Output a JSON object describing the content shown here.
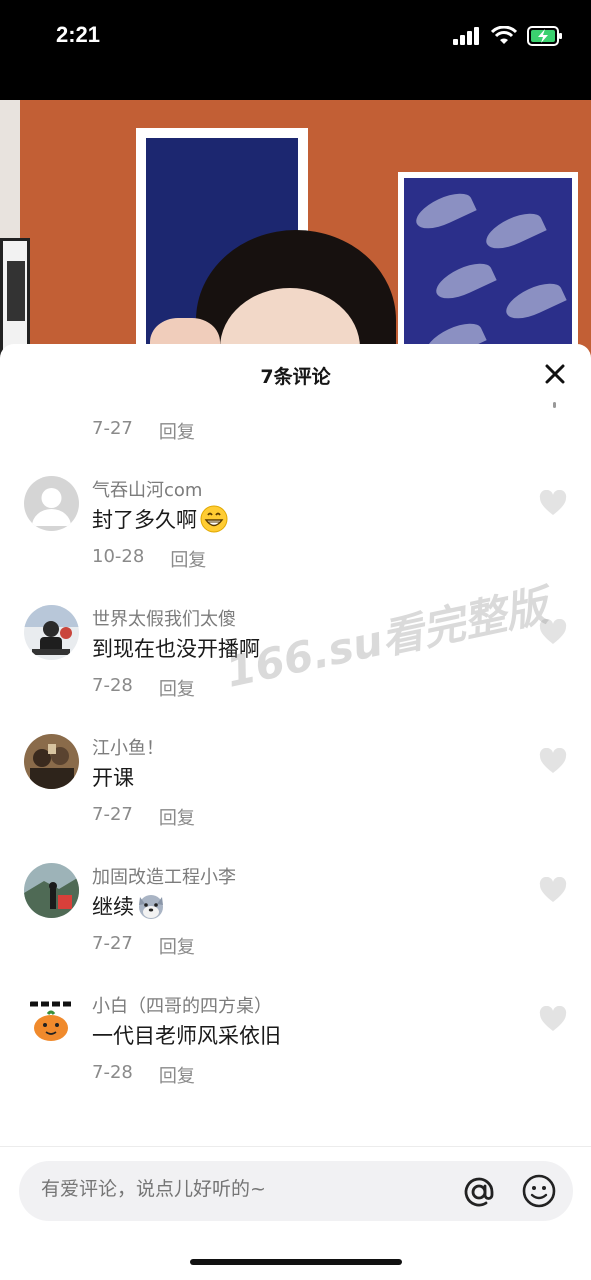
{
  "status_bar": {
    "time": "2:21"
  },
  "sheet": {
    "title": "7条评论"
  },
  "partial_comment": {
    "date": "7-27",
    "reply_label": "回复"
  },
  "comments": [
    {
      "name": "气吞山河com",
      "text": "封了多久啊",
      "emoji": "grin-emoji",
      "date": "10-28",
      "reply_label": "回复"
    },
    {
      "name": "世界太假我们太傻",
      "text": "到现在也没开播啊",
      "date": "7-28",
      "reply_label": "回复"
    },
    {
      "name": "江小鱼！",
      "text": "开课",
      "date": "7-27",
      "reply_label": "回复"
    },
    {
      "name": "加固改造工程小李",
      "text": "继续",
      "emoji": "doge-emoji",
      "date": "7-27",
      "reply_label": "回复"
    },
    {
      "name": "小白（四哥的四方桌）",
      "text": "一代目老师风采依旧",
      "date": "7-28",
      "reply_label": "回复"
    }
  ],
  "watermark": "166.su看完整版",
  "input": {
    "placeholder": "有爱评论，说点儿好听的~"
  },
  "colors": {
    "like_icon": "#e3e3e3",
    "meta_text": "#8a8a8a"
  }
}
